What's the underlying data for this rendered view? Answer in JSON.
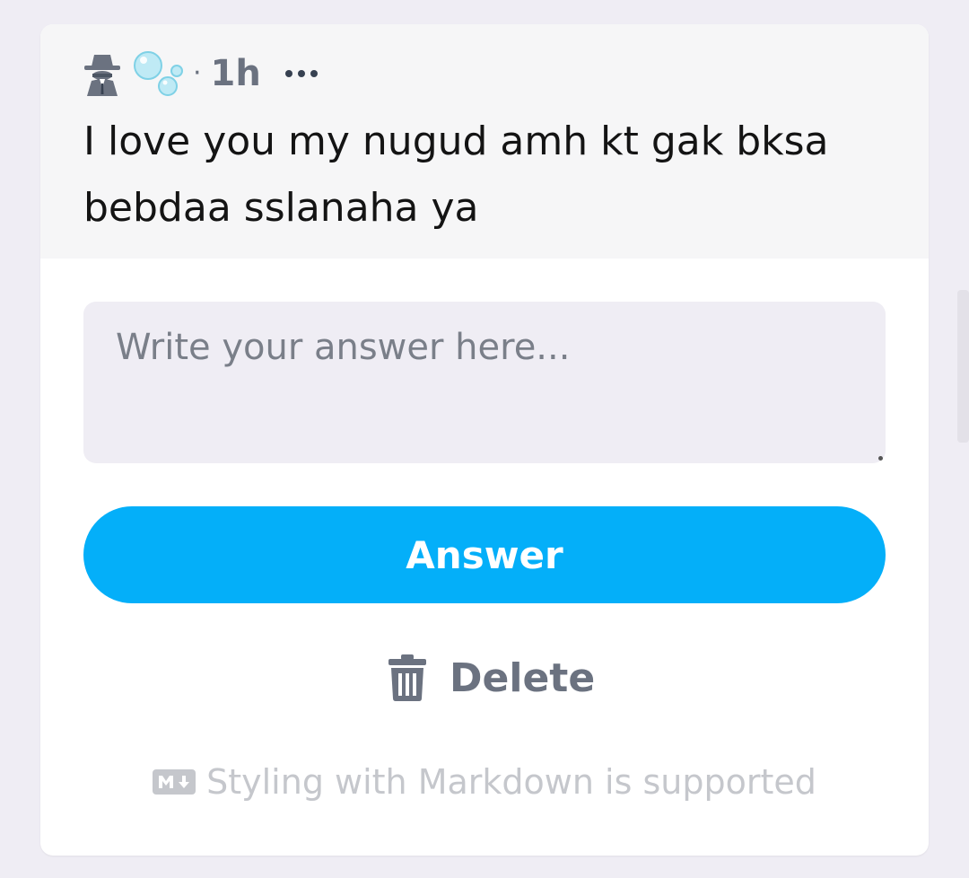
{
  "question": {
    "author_icon": "spy-icon",
    "badge_icon": "bubbles-icon",
    "separator": "·",
    "time": "1h",
    "more_icon": "more-icon",
    "text": "I love you my nugud amh kt gak bksa bebdaa sslanaha ya"
  },
  "answer_form": {
    "placeholder": "Write your answer here...",
    "value": "",
    "submit_label": "Answer",
    "delete_label": "Delete",
    "delete_icon": "trash-icon",
    "markdown_icon": "markdown-icon",
    "markdown_hint": "Styling with Markdown is supported"
  },
  "colors": {
    "accent": "#04aff9",
    "muted_text": "#6b7280",
    "input_background": "#efedf4",
    "page_background": "#efedf4"
  }
}
